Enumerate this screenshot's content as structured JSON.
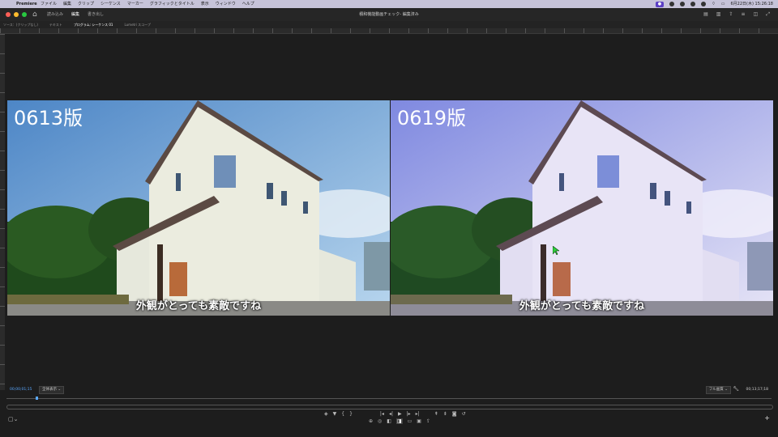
{
  "menubar": {
    "app_name": "Premiere",
    "menus": [
      "ファイル",
      "編集",
      "クリップ",
      "シーケンス",
      "マーカー",
      "グラフィックとタイトル",
      "表示",
      "ウィンドウ",
      "ヘルプ"
    ],
    "recording_label": "",
    "clock": "6月22日(木)  15:26:18"
  },
  "titlebar": {
    "workspaces": [
      "読み込み",
      "編集",
      "書き出し"
    ],
    "active_workspace": "編集",
    "document_title": "積和機能動画チェック- 編集済み"
  },
  "panel_tabs": {
    "tabs": [
      "ソース：(クリップなし)",
      "テキスト",
      "プログラム: シーケンス 01",
      "Lumetri スコープ"
    ],
    "active": "プログラム: シーケンス 01"
  },
  "viewer": {
    "left_label": "0613版",
    "right_label": "0619版",
    "left_caption": "外観がとっても素敵ですね",
    "right_caption": "外観がとっても素敵ですね"
  },
  "controls": {
    "timecode_current": "00;00;01;15",
    "fit_select": "全体表示",
    "resolution_select": "フル画質",
    "timecode_duration": "00;13;17;18"
  },
  "colors": {
    "accent": "#5aa8ff",
    "panel_bg": "#1d1d1d",
    "menubar_bg": "#c6c3d9"
  }
}
